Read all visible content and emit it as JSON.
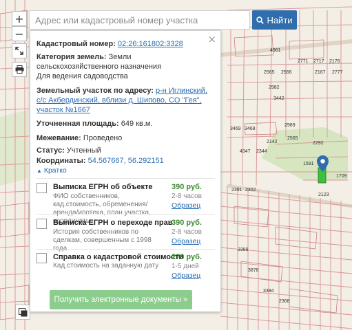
{
  "search": {
    "placeholder": "Адрес или кадастровый номер участка",
    "button_label": "Найти"
  },
  "map_controls": {
    "zoom_in": "+",
    "zoom_out": "−"
  },
  "panel": {
    "close_label": "×",
    "cadastral_label": "Кадастровый номер:",
    "cadastral_value": "02:26:161802:3328",
    "category_label": "Категория земель:",
    "category_value": "Земли сельскохозяйственного назначения",
    "usage_value": "Для ведения садоводства",
    "address_label": "Земельный участок по адресу:",
    "address_value": "р-н Иглинский, с/с Акбердинский, вблизи д. Шипово, СО \"Гея\", участок №1667",
    "area_label": "Уточненная площадь:",
    "area_value": "649 кв.м.",
    "survey_label": "Межевание:",
    "survey_value": "Проведено",
    "status_label": "Статус:",
    "status_value": "Учтенный",
    "coords_label": "Координаты:",
    "coords_value": "54.567667, 56.292151",
    "collapse_label": "Кратко",
    "products": [
      {
        "title": "Выписка ЕГРН об объекте",
        "desc": "ФИО собственников, кад.стоимость, обременения/аренда/ипотека, план участка, координаты",
        "price": "390 руб.",
        "time": "2-8 часов",
        "sample": "Образец"
      },
      {
        "title": "Выписка ЕГРН о переходе прав",
        "desc": "История собственников по сделкам, совершенным с 1998 года",
        "price": "390 руб.",
        "time": "2-8 часов",
        "sample": "Образец"
      },
      {
        "title": "Справка о кадастровой стоимости",
        "desc": "Кад.стоимость на заданную дату",
        "price": "279 руб.",
        "time": "1-5 дней",
        "sample": "Образец"
      }
    ],
    "get_button": "Получить электронные документы »"
  },
  "map_labels": [
    "4961",
    "2717",
    "2771",
    "2176",
    "2565",
    "2566",
    "2167",
    "2777",
    "3442",
    "2982",
    "2989",
    "2142",
    "2565",
    "4347",
    "2344",
    "1591",
    "2292",
    "1709",
    "2123",
    "2391",
    "2302",
    "3469",
    "3468",
    "3389",
    "3878",
    "3394",
    "2368"
  ],
  "colors": {
    "accent": "#2f6dad",
    "price": "#3f8a35",
    "button_green": "#8ccd8e",
    "parcel_line": "#d99a9a",
    "selected_parcel": "#3fbf3f"
  }
}
